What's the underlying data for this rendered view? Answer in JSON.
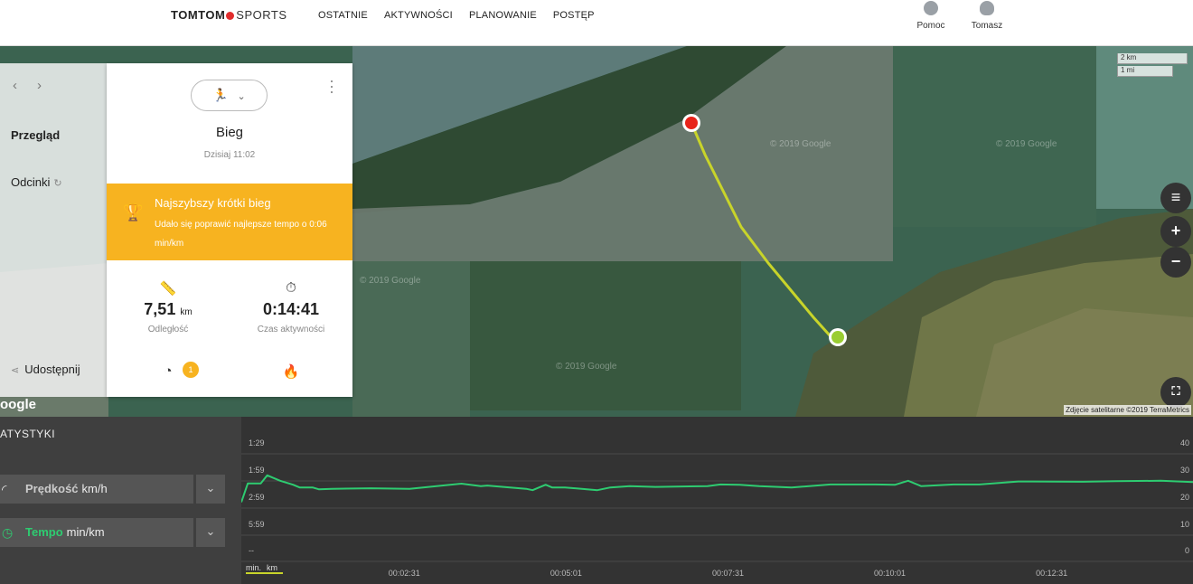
{
  "nav": {
    "brand_main": "TOMTOM",
    "brand_sub": "SPORTS",
    "links": [
      "OSTATNIE",
      "AKTYWNOŚCI",
      "PLANOWANIE",
      "POSTĘP"
    ],
    "help_label": "Pomoc",
    "user_label": "Tomasz"
  },
  "sidebar": {
    "prev_icon": "chevron-left-icon",
    "next_icon": "chevron-right-icon",
    "items": [
      {
        "label": "Przegląd"
      },
      {
        "label": "Odcinki"
      },
      {
        "label": "Udostępnij"
      }
    ]
  },
  "card": {
    "sport_icon": "running-icon",
    "title": "Bieg",
    "date": "Dzisiaj 11:02",
    "achievement": {
      "title": "Najszybszy krótki bieg",
      "description": "Udało się poprawić najlepsze tempo o 0:06 min/km"
    },
    "stats": [
      {
        "icon": "ruler-icon",
        "value": "7,51",
        "unit": "km",
        "label": "Odległość"
      },
      {
        "icon": "stopwatch-icon",
        "value": "0:14:41",
        "unit": "",
        "label": "Czas aktywności"
      }
    ],
    "lower_icons": [
      "speedometer-icon",
      "flame-icon"
    ],
    "badge": "1"
  },
  "map": {
    "watermark": "© 2019 Google",
    "scale_km": "2 km",
    "scale_mi": "1 mi",
    "google_logo": "oogle",
    "credit": "Zdjęcie satelitarne ©2019 TerraMetrics",
    "route_color": "#c8d42a",
    "start_color": "#9acd32",
    "end_color": "#e8231a"
  },
  "stats": {
    "title": "ATYSTYKI",
    "metrics": [
      {
        "name": "Prędkość",
        "unit": "km/h",
        "icon": "speedometer-icon"
      },
      {
        "name": "Tempo",
        "unit": "min/km",
        "icon": "pace-icon"
      }
    ],
    "unit_toggle": [
      "min.",
      "km"
    ],
    "accent": "#2ecc71"
  },
  "chart_data": {
    "type": "line",
    "title": "",
    "xlabel": "",
    "ylabel": "",
    "x_ticks": [
      "00:02:31",
      "00:05:01",
      "00:07:31",
      "00:10:01",
      "00:12:31"
    ],
    "y_left_ticks": [
      "1:29",
      "1:59",
      "2:59",
      "5:59",
      "--"
    ],
    "y_right_ticks": [
      "40",
      "30",
      "20",
      "10",
      "0"
    ],
    "ylim_right": [
      0,
      40
    ],
    "series": [
      {
        "name": "Prędkość",
        "color": "#2ecc71",
        "x_minutes": [
          0.0,
          0.1,
          0.3,
          0.4,
          0.6,
          0.8,
          0.9,
          1.1,
          1.2,
          1.4,
          2.0,
          2.6,
          3.4,
          3.7,
          3.8,
          4.4,
          4.5,
          4.7,
          4.8,
          5.0,
          5.5,
          5.7,
          6.0,
          6.4,
          7.2,
          7.4,
          7.7,
          8.0,
          8.5,
          9.1,
          9.8,
          10.1,
          10.3,
          10.5,
          11.0,
          11.4,
          12.0,
          13.0,
          13.5,
          14.2,
          14.7
        ],
        "values": [
          22.0,
          29.0,
          29.0,
          32.0,
          30.0,
          28.5,
          27.5,
          27.5,
          26.8,
          27.0,
          27.2,
          27.0,
          28.9,
          28.0,
          28.2,
          27.0,
          26.5,
          28.5,
          27.5,
          27.5,
          26.5,
          27.5,
          28.0,
          27.7,
          28.0,
          28.6,
          28.5,
          28.0,
          27.5,
          28.6,
          28.6,
          28.5,
          30.0,
          28.0,
          28.6,
          28.6,
          29.7,
          29.6,
          29.8,
          30.0,
          29.5
        ]
      }
    ]
  }
}
